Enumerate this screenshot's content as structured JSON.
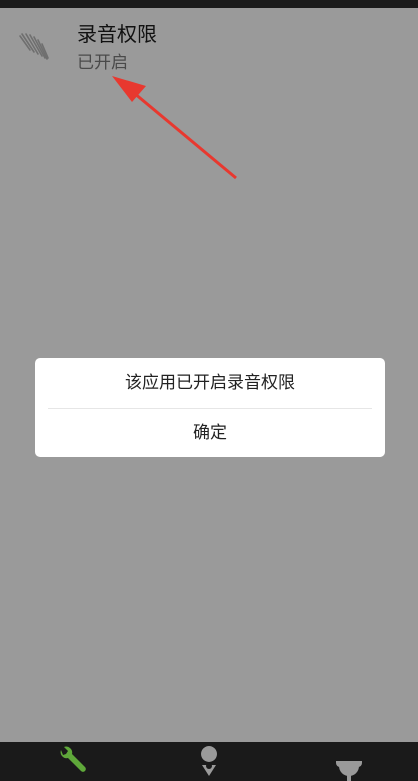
{
  "permission": {
    "title": "录音权限",
    "status": "已开启",
    "icon": "app-logo-icon"
  },
  "dialog": {
    "message": "该应用已开启录音权限",
    "confirm_label": "确定"
  },
  "nav": {
    "items": [
      {
        "icon": "wrench-icon",
        "active": true
      },
      {
        "icon": "location-pin-icon",
        "active": false
      },
      {
        "icon": "trophy-icon",
        "active": false
      }
    ]
  },
  "colors": {
    "overlay": "#9a9a9a",
    "nav_background": "#1a1a1a",
    "active_icon": "#5fa83a",
    "inactive_icon": "#9a9a9a",
    "annotation_arrow": "#e8382f"
  }
}
